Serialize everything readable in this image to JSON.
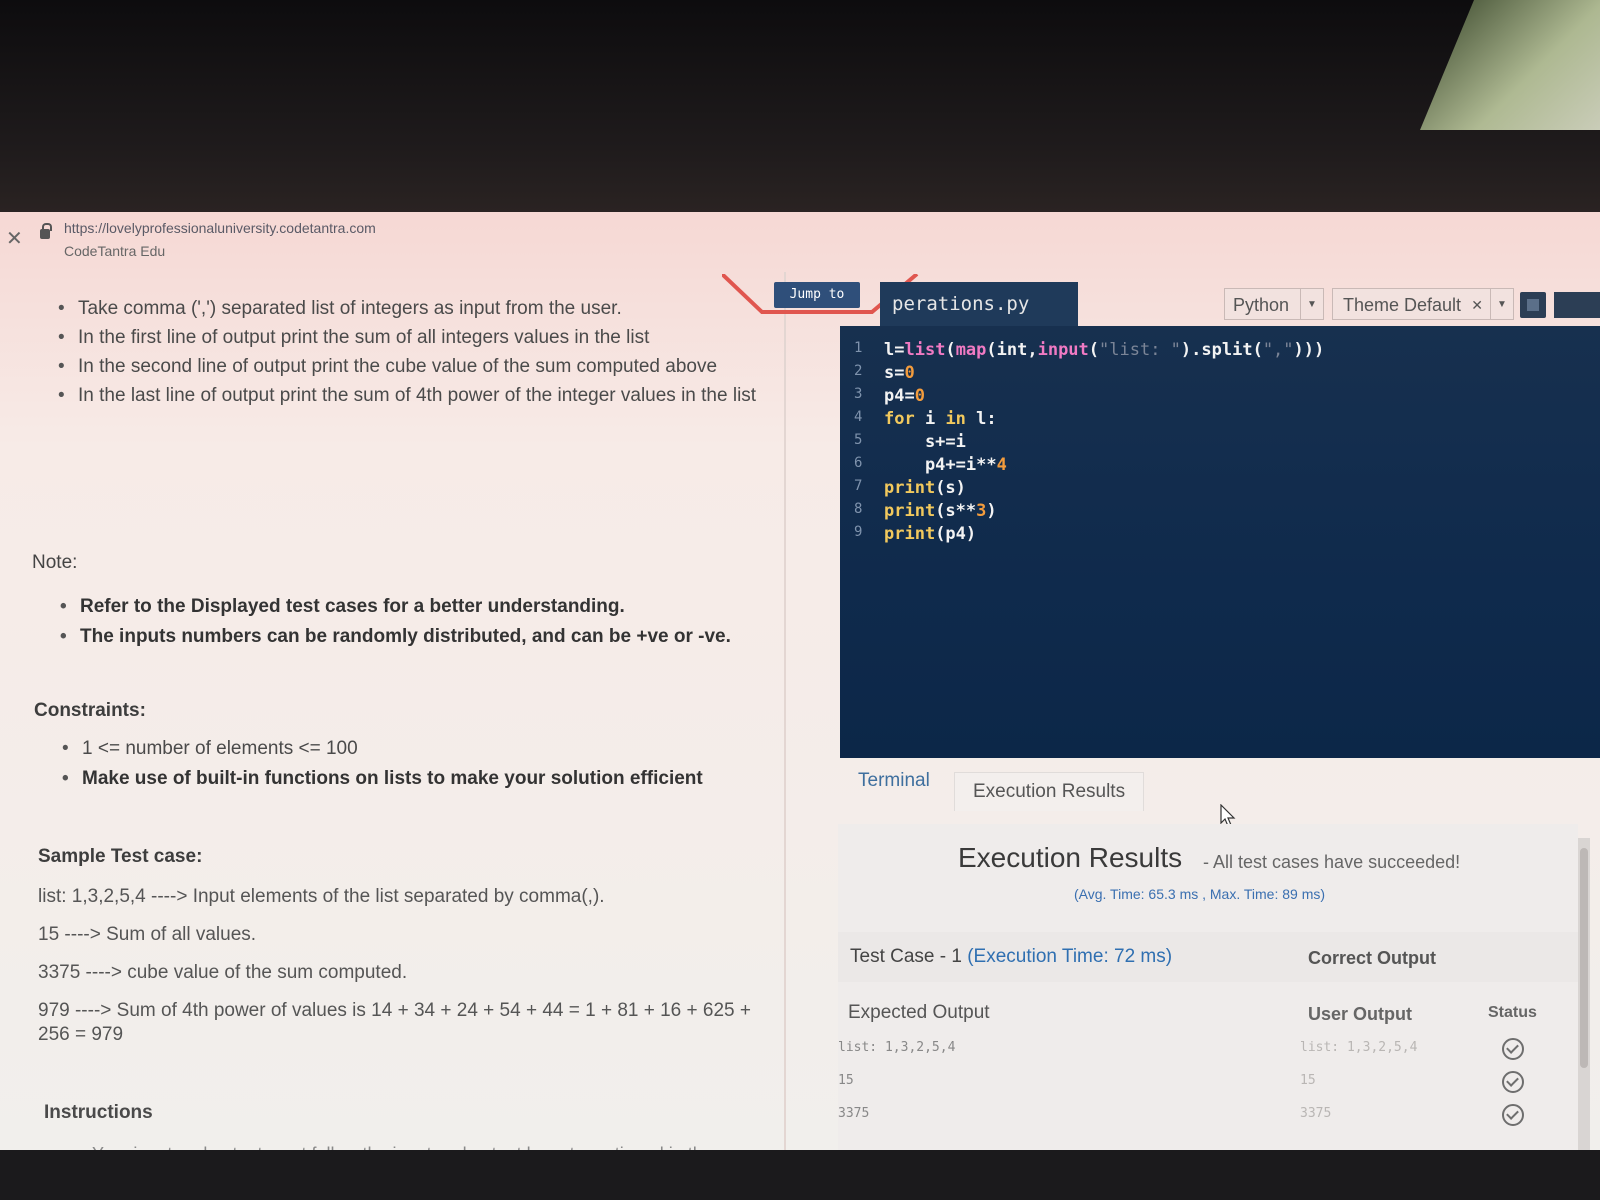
{
  "browser": {
    "url": "https://lovelyprofessionaluniversity.codetantra.com",
    "site_name": "CodeTantra Edu"
  },
  "problem": {
    "bullets": [
      "Take comma (',') separated list of integers as input from the user.",
      "In the first line of output print the sum of all integers values in the list",
      "In the second line of output print the cube value of the sum computed above",
      "In the last line of output print the sum of 4th power of the integer values in the list"
    ],
    "note_heading": "Note:",
    "note_bullets": [
      "Refer to the Displayed test cases for a better understanding.",
      "The inputs numbers can be randomly distributed, and can be +ve or -ve."
    ],
    "constraints_heading": "Constraints:",
    "constraints": [
      "1 <= number of elements <= 100",
      "Make use of built-in functions on lists to make your solution efficient"
    ],
    "sample_heading": "Sample Test case:",
    "sample_lines": [
      "list: 1,3,2,5,4 ----> Input elements of the list separated by comma(,).",
      "15 ----> Sum of all values.",
      "3375 ----> cube value of the sum computed.",
      "979 ----> Sum of 4th power of values is 14 + 34 + 24 + 54 + 44 = 1 + 81 + 16 + 625 +",
      "256 = 979"
    ],
    "instructions_heading": "Instructions",
    "instructions": [
      "Your input and output must follow the input and output layout mentioned in the visible sample test case."
    ]
  },
  "editor": {
    "jump_label": "Jump to",
    "file_name": "perations.py",
    "language": "Python",
    "theme": "Theme Default",
    "lines": [
      {
        "n": "1",
        "text": "l=list(map(int,input(\"list: \").split(\",\")))"
      },
      {
        "n": "2",
        "text": "s=0"
      },
      {
        "n": "3",
        "text": "p4=0"
      },
      {
        "n": "4",
        "text": "for i in l:"
      },
      {
        "n": "5",
        "text": "    s+=i"
      },
      {
        "n": "6",
        "text": "    p4+=i**4"
      },
      {
        "n": "7",
        "text": "print(s)"
      },
      {
        "n": "8",
        "text": "print(s**3)"
      },
      {
        "n": "9",
        "text": "print(p4)"
      }
    ]
  },
  "tabs": {
    "terminal": "Terminal",
    "execution": "Execution Results"
  },
  "results": {
    "title": "Execution Results",
    "subtitle": "- All test cases have succeeded!",
    "time": "(Avg. Time: 65.3 ms , Max. Time: 89 ms)",
    "test_case_label": "Test Case - 1",
    "test_case_time": "(Execution Time: 72 ms)",
    "correct_label": "Correct Output",
    "expected_header": "Expected Output",
    "user_header": "User Output",
    "status_header": "Status",
    "rows": [
      {
        "expected": "list: 1,3,2,5,4",
        "user": "list: 1,3,2,5,4"
      },
      {
        "expected": "15",
        "user": "15"
      },
      {
        "expected": "3375",
        "user": "3375"
      }
    ]
  },
  "icons": {
    "close": "close-icon",
    "lock": "lock-icon",
    "dropdown": "chevron-down-icon",
    "status": "check-circle-icon",
    "cursor": "mouse-cursor-icon"
  },
  "colors": {
    "editor_bg": "#0f2a4c",
    "link_blue": "#2f6fb1",
    "jump_bg": "#2f4f7a"
  }
}
